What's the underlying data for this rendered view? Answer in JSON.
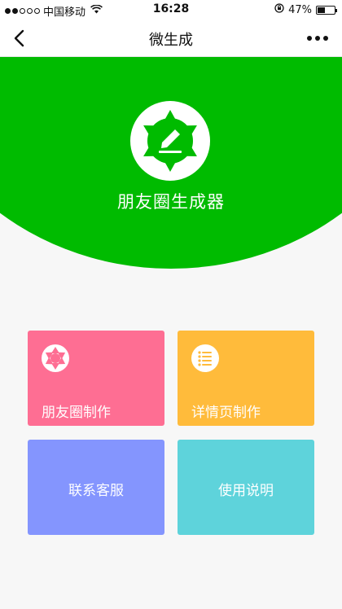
{
  "status_bar": {
    "carrier": "中国移动",
    "time": "16:28",
    "battery_percent": "47%",
    "battery_level": 0.47
  },
  "nav": {
    "title": "微生成",
    "back_icon": "chevron-left-icon",
    "more_icon": "more-dots-icon"
  },
  "hero": {
    "title": "朋友圈生成器",
    "logo_icon": "aperture-pencil-icon",
    "color": "#00bb00"
  },
  "tiles": [
    {
      "label": "朋友圈制作",
      "icon": "aperture-icon",
      "color": "#fe6e93"
    },
    {
      "label": "详情页制作",
      "icon": "list-icon",
      "color": "#ffbb3b"
    },
    {
      "label": "联系客服",
      "color": "#8495fe"
    },
    {
      "label": "使用说明",
      "color": "#5ed3db"
    }
  ]
}
